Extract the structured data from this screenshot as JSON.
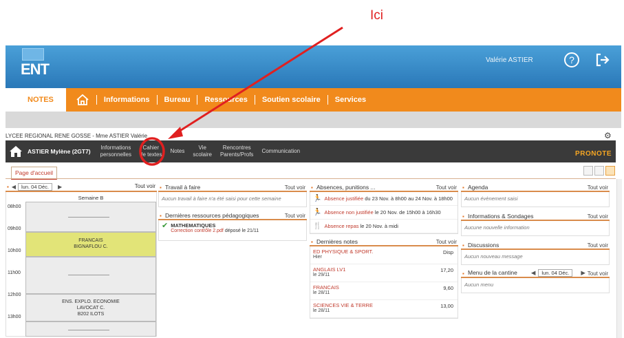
{
  "annotation": {
    "label": "Ici",
    "color": "#e02020"
  },
  "ent": {
    "logo_text": "ENT",
    "user_name": "Valérie ASTIER",
    "help_glyph": "?",
    "nav": {
      "notes": "NOTES",
      "items": [
        "Informations",
        "Bureau",
        "Ressources",
        "Soutien scolaire",
        "Services"
      ]
    }
  },
  "pronote": {
    "school_line": "LYCEE REGIONAL RENE GOSSE - Mme ASTIER Valérie",
    "student": "ASTIER Mylène (2GT7)",
    "menu": [
      {
        "l1": "Informations",
        "l2": "personnelles"
      },
      {
        "l1": "Cahier",
        "l2": "de textes"
      },
      {
        "l1": "Notes",
        "l2": ""
      },
      {
        "l1": "Vie",
        "l2": "scolaire"
      },
      {
        "l1": "Rencontres",
        "l2": "Parents/Profs"
      },
      {
        "l1": "Communication",
        "l2": ""
      }
    ],
    "logo": "PRONOTE",
    "page_tab": "Page d'accueil"
  },
  "edt": {
    "date": "lun. 04 Déc.",
    "tout_voir": "Tout voir",
    "week": "Semaine B",
    "hours": [
      "08h00",
      "09h00",
      "10h00",
      "11h00",
      "12h00",
      "13h00"
    ],
    "course1": {
      "l1": "FRANCAIS",
      "l2": "BIGNAFLOU C."
    },
    "course2": {
      "l1": "ENS. EXPLO. ECONOMIE",
      "l2": "LAVOCAT C.",
      "l3": "B202 ILOTS"
    }
  },
  "travail": {
    "title": "Travail à faire",
    "tout_voir": "Tout voir",
    "empty": "Aucun travail à faire n'a été saisi pour cette semaine"
  },
  "ressources": {
    "title": "Dernières ressources pédagogiques",
    "tout_voir": "Tout voir",
    "item_title": "MATHEMATIQUES",
    "item_link": "Correction contrôle 2.pdf",
    "item_suffix": " déposé le 21/11"
  },
  "absences": {
    "title": "Absences, punitions ...",
    "tout_voir": "Tout voir",
    "items": [
      {
        "red": "Absence justifiée",
        "rest": " du 23 Nov. à 8h00 au 24 Nov. à 18h00"
      },
      {
        "red": "Absence non justifiée",
        "rest": " le 20 Nov. de 15h00 à 16h30"
      },
      {
        "red": "Absence repas",
        "rest": " le 20 Nov. à midi"
      }
    ]
  },
  "notes": {
    "title": "Dernières notes",
    "tout_voir": "Tout voir",
    "rows": [
      {
        "subject": "ED PHYSIQUE & SPORT.",
        "date": "Hier",
        "value": "Disp"
      },
      {
        "subject": "ANGLAIS LV1",
        "date": "le 29/11",
        "value": "17,20"
      },
      {
        "subject": "FRANCAIS",
        "date": "le 28/11",
        "value": "9,60"
      },
      {
        "subject": "SCIENCES VIE & TERRE",
        "date": "le 28/11",
        "value": "13,00"
      }
    ]
  },
  "agenda": {
    "title": "Agenda",
    "tout_voir": "Tout voir",
    "empty": "Aucun évènement saisi"
  },
  "infos": {
    "title": "Informations & Sondages",
    "tout_voir": "Tout voir",
    "empty": "Aucune nouvelle information"
  },
  "discussions": {
    "title": "Discussions",
    "tout_voir": "Tout voir",
    "empty": "Aucun nouveau message"
  },
  "cantine": {
    "title": "Menu de la cantine",
    "date": "lun. 04 Déc.",
    "tout_voir": "Tout voir",
    "empty": "Aucun menu"
  },
  "colors": {
    "orange": "#f18a1c",
    "blue": "#2a78b8",
    "dark": "#3a3a3a",
    "red": "#c0392b",
    "highlight": "#e2e478"
  }
}
